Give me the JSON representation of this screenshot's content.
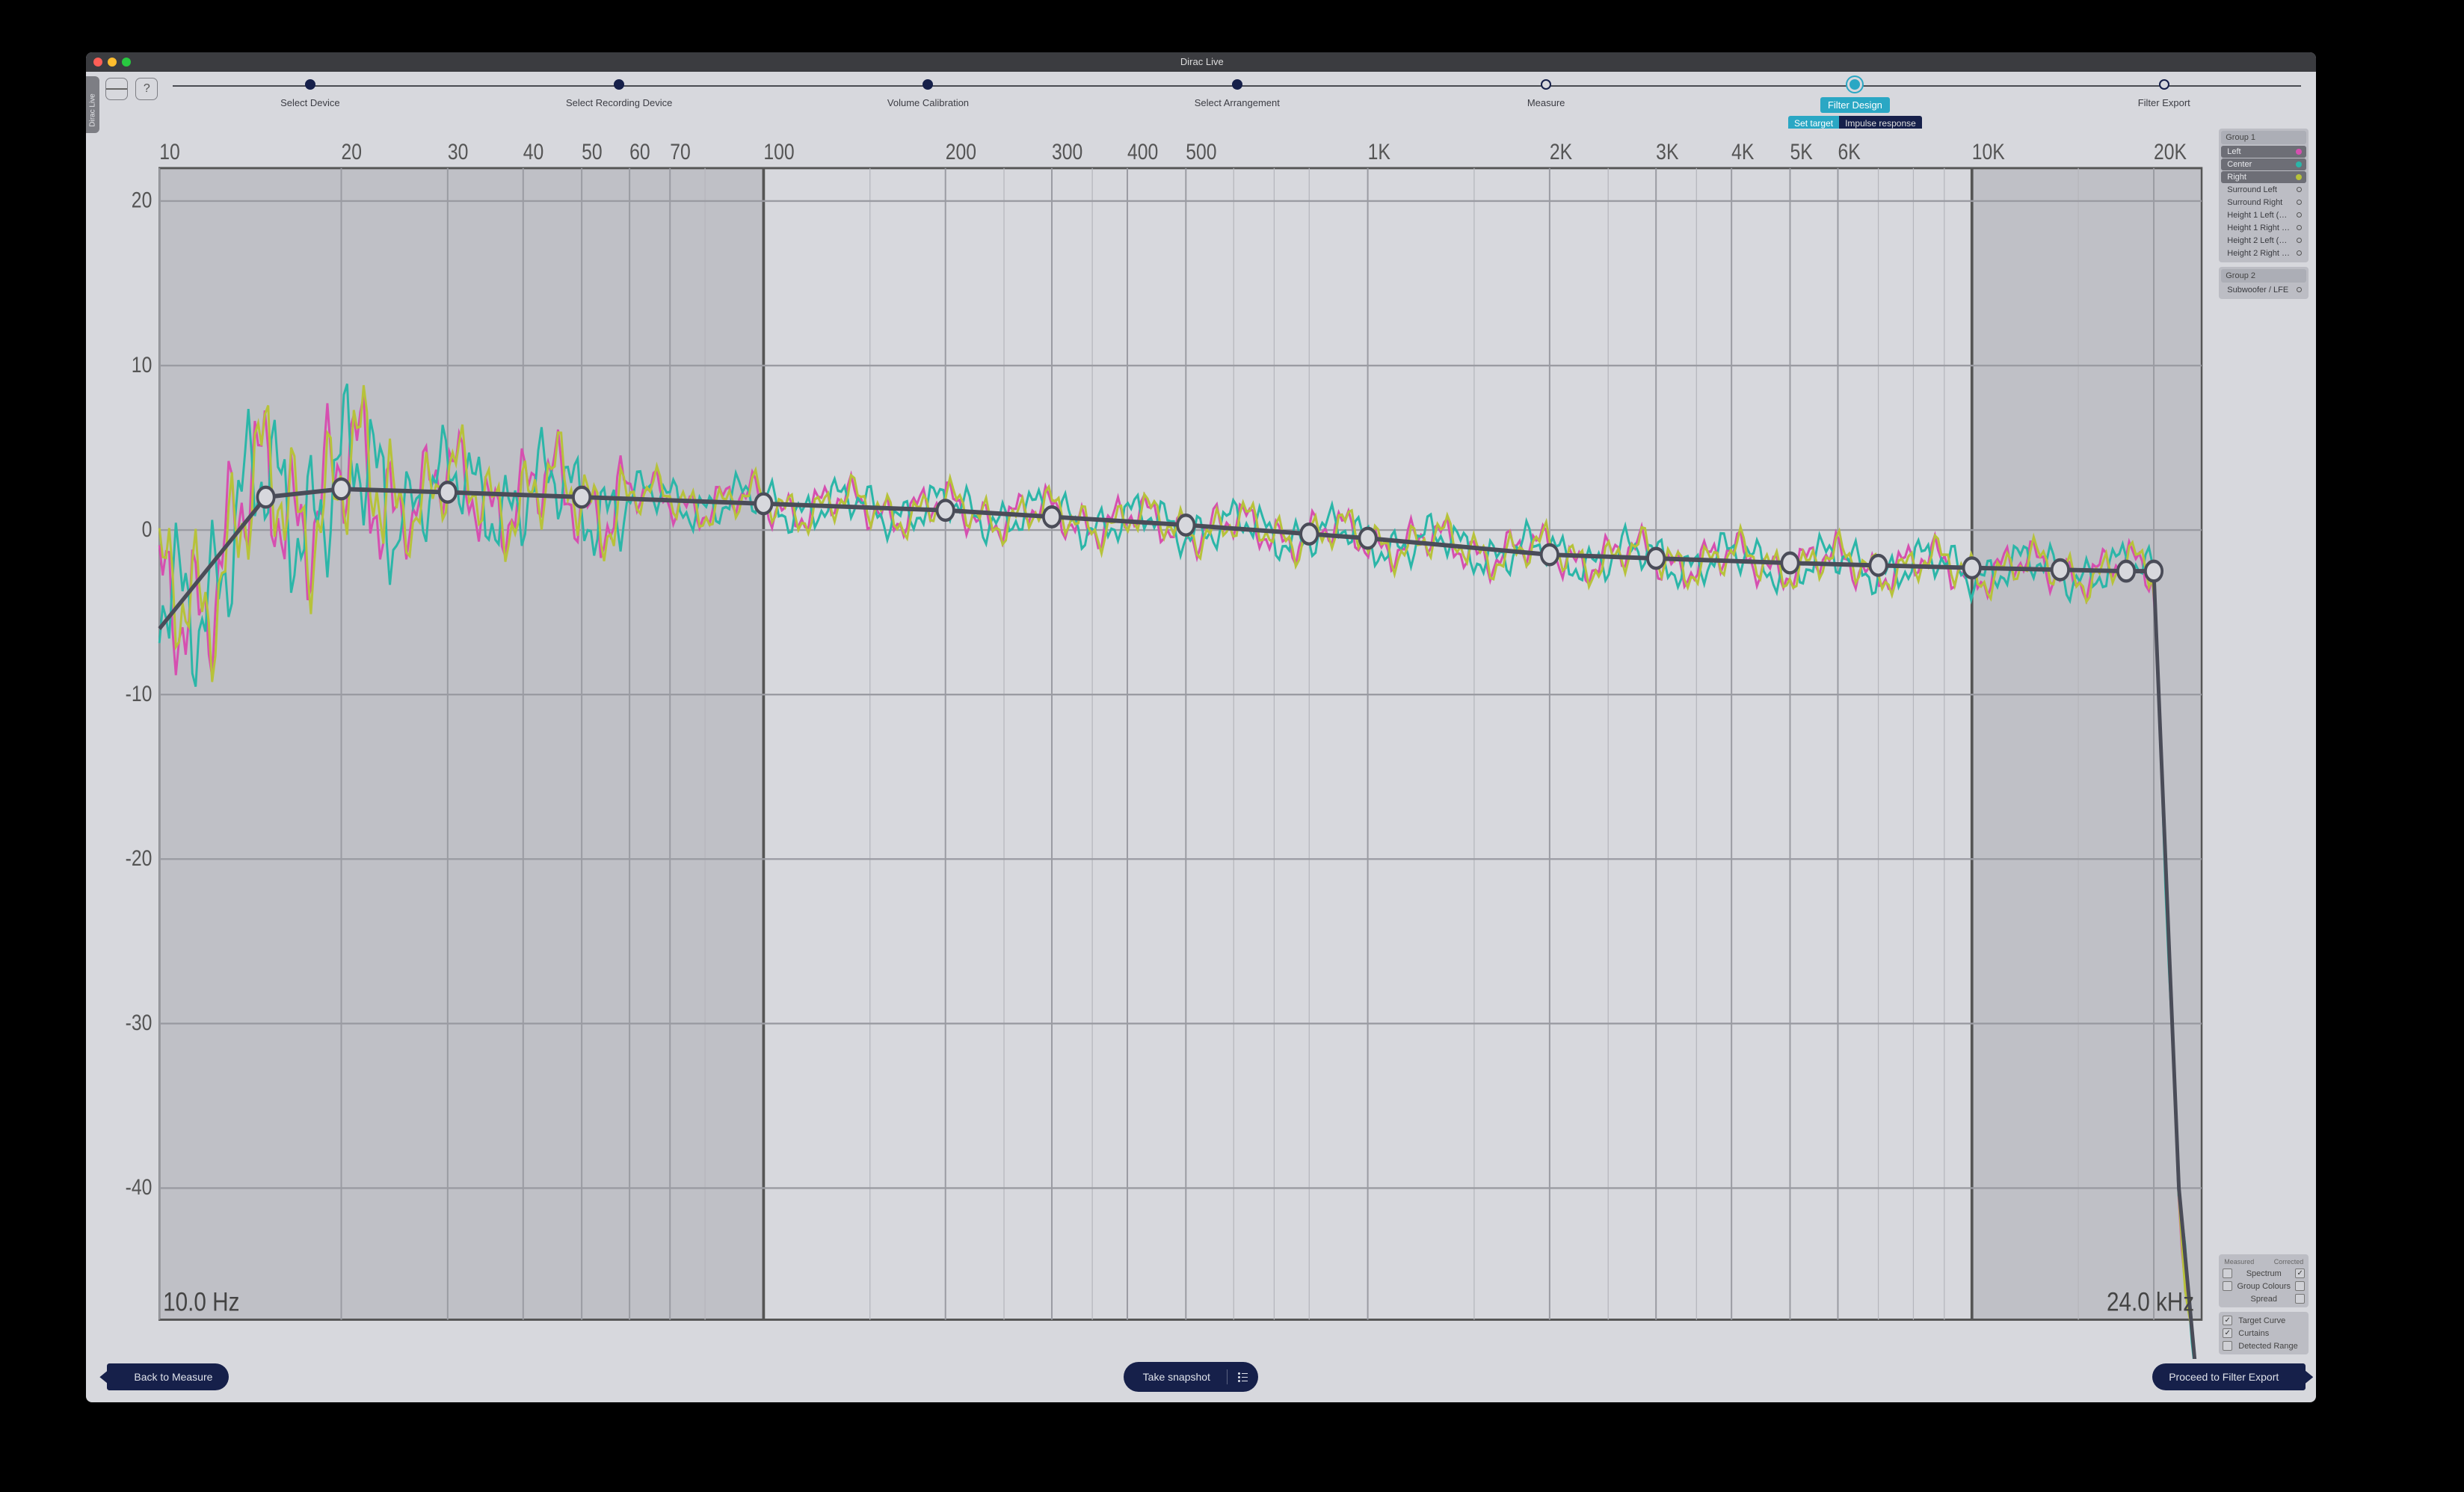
{
  "window": {
    "title": "Dirac Live"
  },
  "side_tab": "Dirac Live",
  "stepper": {
    "steps": [
      {
        "label": "Select Device",
        "state": "done"
      },
      {
        "label": "Select Recording Device",
        "state": "done"
      },
      {
        "label": "Volume Calibration",
        "state": "done"
      },
      {
        "label": "Select Arrangement",
        "state": "done"
      },
      {
        "label": "Measure",
        "state": "hollow"
      },
      {
        "label": "Filter Design",
        "state": "active"
      },
      {
        "label": "Filter Export",
        "state": "hollow"
      }
    ],
    "sub_tabs": {
      "a": "Set target",
      "b": "Impulse response"
    }
  },
  "chart_data": {
    "type": "line",
    "xlabel_min": "10.0 Hz",
    "xlabel_max": "24.0 kHz",
    "x_ticks": [
      "10",
      "20",
      "30",
      "40",
      "50",
      "60",
      "70",
      "",
      "100",
      "",
      "200",
      "",
      "300",
      "",
      "400",
      "500",
      "",
      "",
      "",
      "1K",
      "",
      "2K",
      "",
      "3K",
      "",
      "4K",
      "5K",
      "6K",
      "",
      "",
      "",
      "10K",
      "",
      "20K"
    ],
    "x_tick_hz": [
      10,
      20,
      30,
      40,
      50,
      60,
      70,
      80,
      100,
      150,
      200,
      250,
      300,
      350,
      400,
      500,
      600,
      700,
      800,
      1000,
      1500,
      2000,
      2500,
      3000,
      3500,
      4000,
      5000,
      6000,
      7000,
      8000,
      9000,
      10000,
      15000,
      20000
    ],
    "y_ticks": [
      20,
      10,
      0,
      -10,
      -20,
      -30,
      -40
    ],
    "ylim": [
      -48,
      22
    ],
    "target_curve": [
      {
        "hz": 10,
        "db": -6
      },
      {
        "hz": 15,
        "db": 2
      },
      {
        "hz": 20,
        "db": 2.5
      },
      {
        "hz": 30,
        "db": 2.3
      },
      {
        "hz": 50,
        "db": 2
      },
      {
        "hz": 100,
        "db": 1.6
      },
      {
        "hz": 200,
        "db": 1.2
      },
      {
        "hz": 500,
        "db": 0.3
      },
      {
        "hz": 1000,
        "db": -0.5
      },
      {
        "hz": 2000,
        "db": -1.5
      },
      {
        "hz": 5000,
        "db": -2
      },
      {
        "hz": 10000,
        "db": -2.3
      },
      {
        "hz": 18000,
        "db": -2.5
      },
      {
        "hz": 20000,
        "db": -2.5
      },
      {
        "hz": 22000,
        "db": -40
      },
      {
        "hz": 24000,
        "db": -55
      }
    ],
    "curtain_low_hz": 100,
    "curtain_high_hz": 10000,
    "series": [
      {
        "name": "Left",
        "color": "#d64fb0"
      },
      {
        "name": "Center",
        "color": "#2bb6a8"
      },
      {
        "name": "Right",
        "color": "#b7c23a"
      }
    ]
  },
  "groups": [
    {
      "name": "Group 1",
      "channels": [
        {
          "name": "Left",
          "color": "#d64fb0",
          "selected": true
        },
        {
          "name": "Center",
          "color": "#2bb6a8",
          "selected": true
        },
        {
          "name": "Right",
          "color": "#b7c23a",
          "selected": true
        },
        {
          "name": "Surround Left",
          "selected": false
        },
        {
          "name": "Surround Right",
          "selected": false
        },
        {
          "name": "Height 1 Left (…",
          "selected": false
        },
        {
          "name": "Height 1 Right …",
          "selected": false
        },
        {
          "name": "Height 2 Left (…",
          "selected": false
        },
        {
          "name": "Height 2 Right …",
          "selected": false
        }
      ]
    },
    {
      "name": "Group 2",
      "channels": [
        {
          "name": "Subwoofer / LFE",
          "selected": false
        }
      ]
    }
  ],
  "options": {
    "header_left": "Measured",
    "header_right": "Corrected",
    "rows1": [
      {
        "label": "Spectrum",
        "left": false,
        "right": true
      },
      {
        "label": "Group Colours",
        "left": false,
        "right": false
      },
      {
        "label": "Spread",
        "left": null,
        "right": false
      }
    ],
    "rows2": [
      {
        "label": "Target Curve",
        "checked": true
      },
      {
        "label": "Curtains",
        "checked": true
      },
      {
        "label": "Detected Range",
        "checked": false
      }
    ]
  },
  "footer": {
    "back": "Back to Measure",
    "snapshot": "Take snapshot",
    "proceed": "Proceed to Filter Export"
  }
}
